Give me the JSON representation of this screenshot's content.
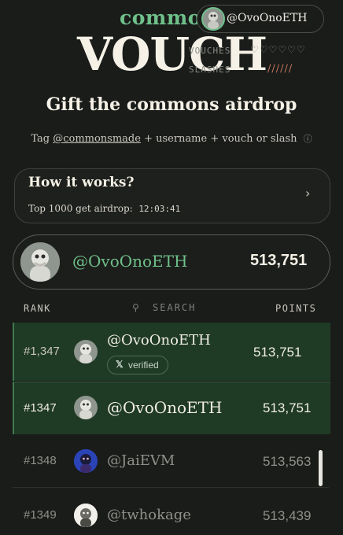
{
  "header": {
    "brand_top": "commo",
    "brand_main": "VOUCH",
    "user_chip": "@OvoOnoETH",
    "vouches_label": "VOUCHES",
    "slashes_label": "SLASHES",
    "hearts": "♡♡♡♡♡♡",
    "slash_marks": "//////"
  },
  "title": "Gift the commons airdrop",
  "tagline": {
    "prefix": "Tag ",
    "handle": "@commonsmade",
    "suffix": " + username + vouch or slash",
    "info_icon": "ⓘ"
  },
  "how_it_works": {
    "title": "How it works?",
    "subtitle": "Top 1000 get airdrop:",
    "countdown": "12:03:41",
    "chevron": "›"
  },
  "current_user": {
    "name": "@OvoOnoETH",
    "points": "513,751"
  },
  "table": {
    "rank_header": "RANK",
    "search_label": "SEARCH",
    "points_header": "POINTS",
    "rows": [
      {
        "rank": "#1,347",
        "name": "@OvoOnoETH",
        "points": "513,751",
        "badge": "verified"
      },
      {
        "rank": "#1347",
        "name": "@OvoOnoETH",
        "points": "513,751"
      },
      {
        "rank": "#1348",
        "name": "@JaiEVM",
        "points": "513,563"
      },
      {
        "rank": "#1349",
        "name": "@twhokage",
        "points": "513,439"
      }
    ]
  },
  "colors": {
    "accent_green": "#6fc08a",
    "highlight_row": "#1f3a25",
    "background": "#1a1c1a"
  }
}
